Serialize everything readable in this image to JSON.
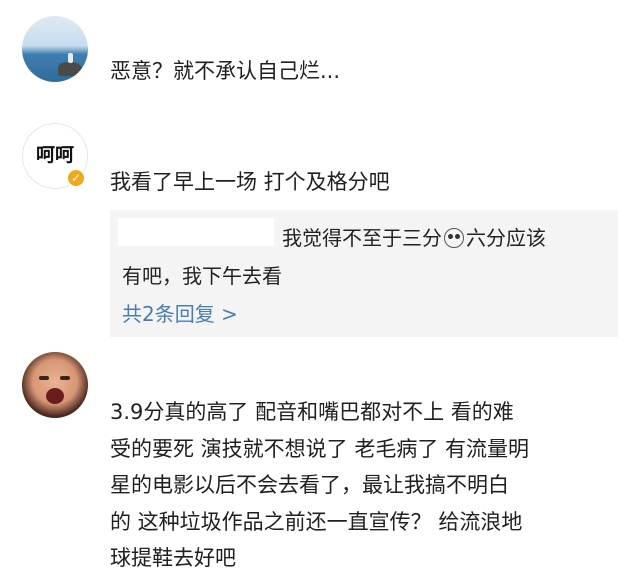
{
  "comments": [
    {
      "text": "恶意？就不承认自己烂..."
    },
    {
      "avatar_text": "呵呵",
      "text": "我看了早上一场  打个及格分吧",
      "reply": {
        "line1_a": "我觉得不至于三分",
        "line1_b": "六分应该",
        "line2": "有吧，我下午去看",
        "more": "共2条回复 >"
      }
    },
    {
      "lines": [
        "3.9分真的高了  配音和嘴巴都对不上  看的难",
        "受的要死  演技就不想说了  老毛病了  有流量明",
        "星的电影以后不会去看了，最让我搞不明白",
        "的  这种垃圾作品之前还一直宣传？  给流浪地",
        "球提鞋去好吧"
      ]
    }
  ],
  "colors": {
    "link": "#4a7db3",
    "reply_bg": "#f4f4f4",
    "verified_badge": "#f2a81d"
  },
  "icons": [
    "verified-badge-icon",
    "shocked-face-emoji-icon"
  ]
}
